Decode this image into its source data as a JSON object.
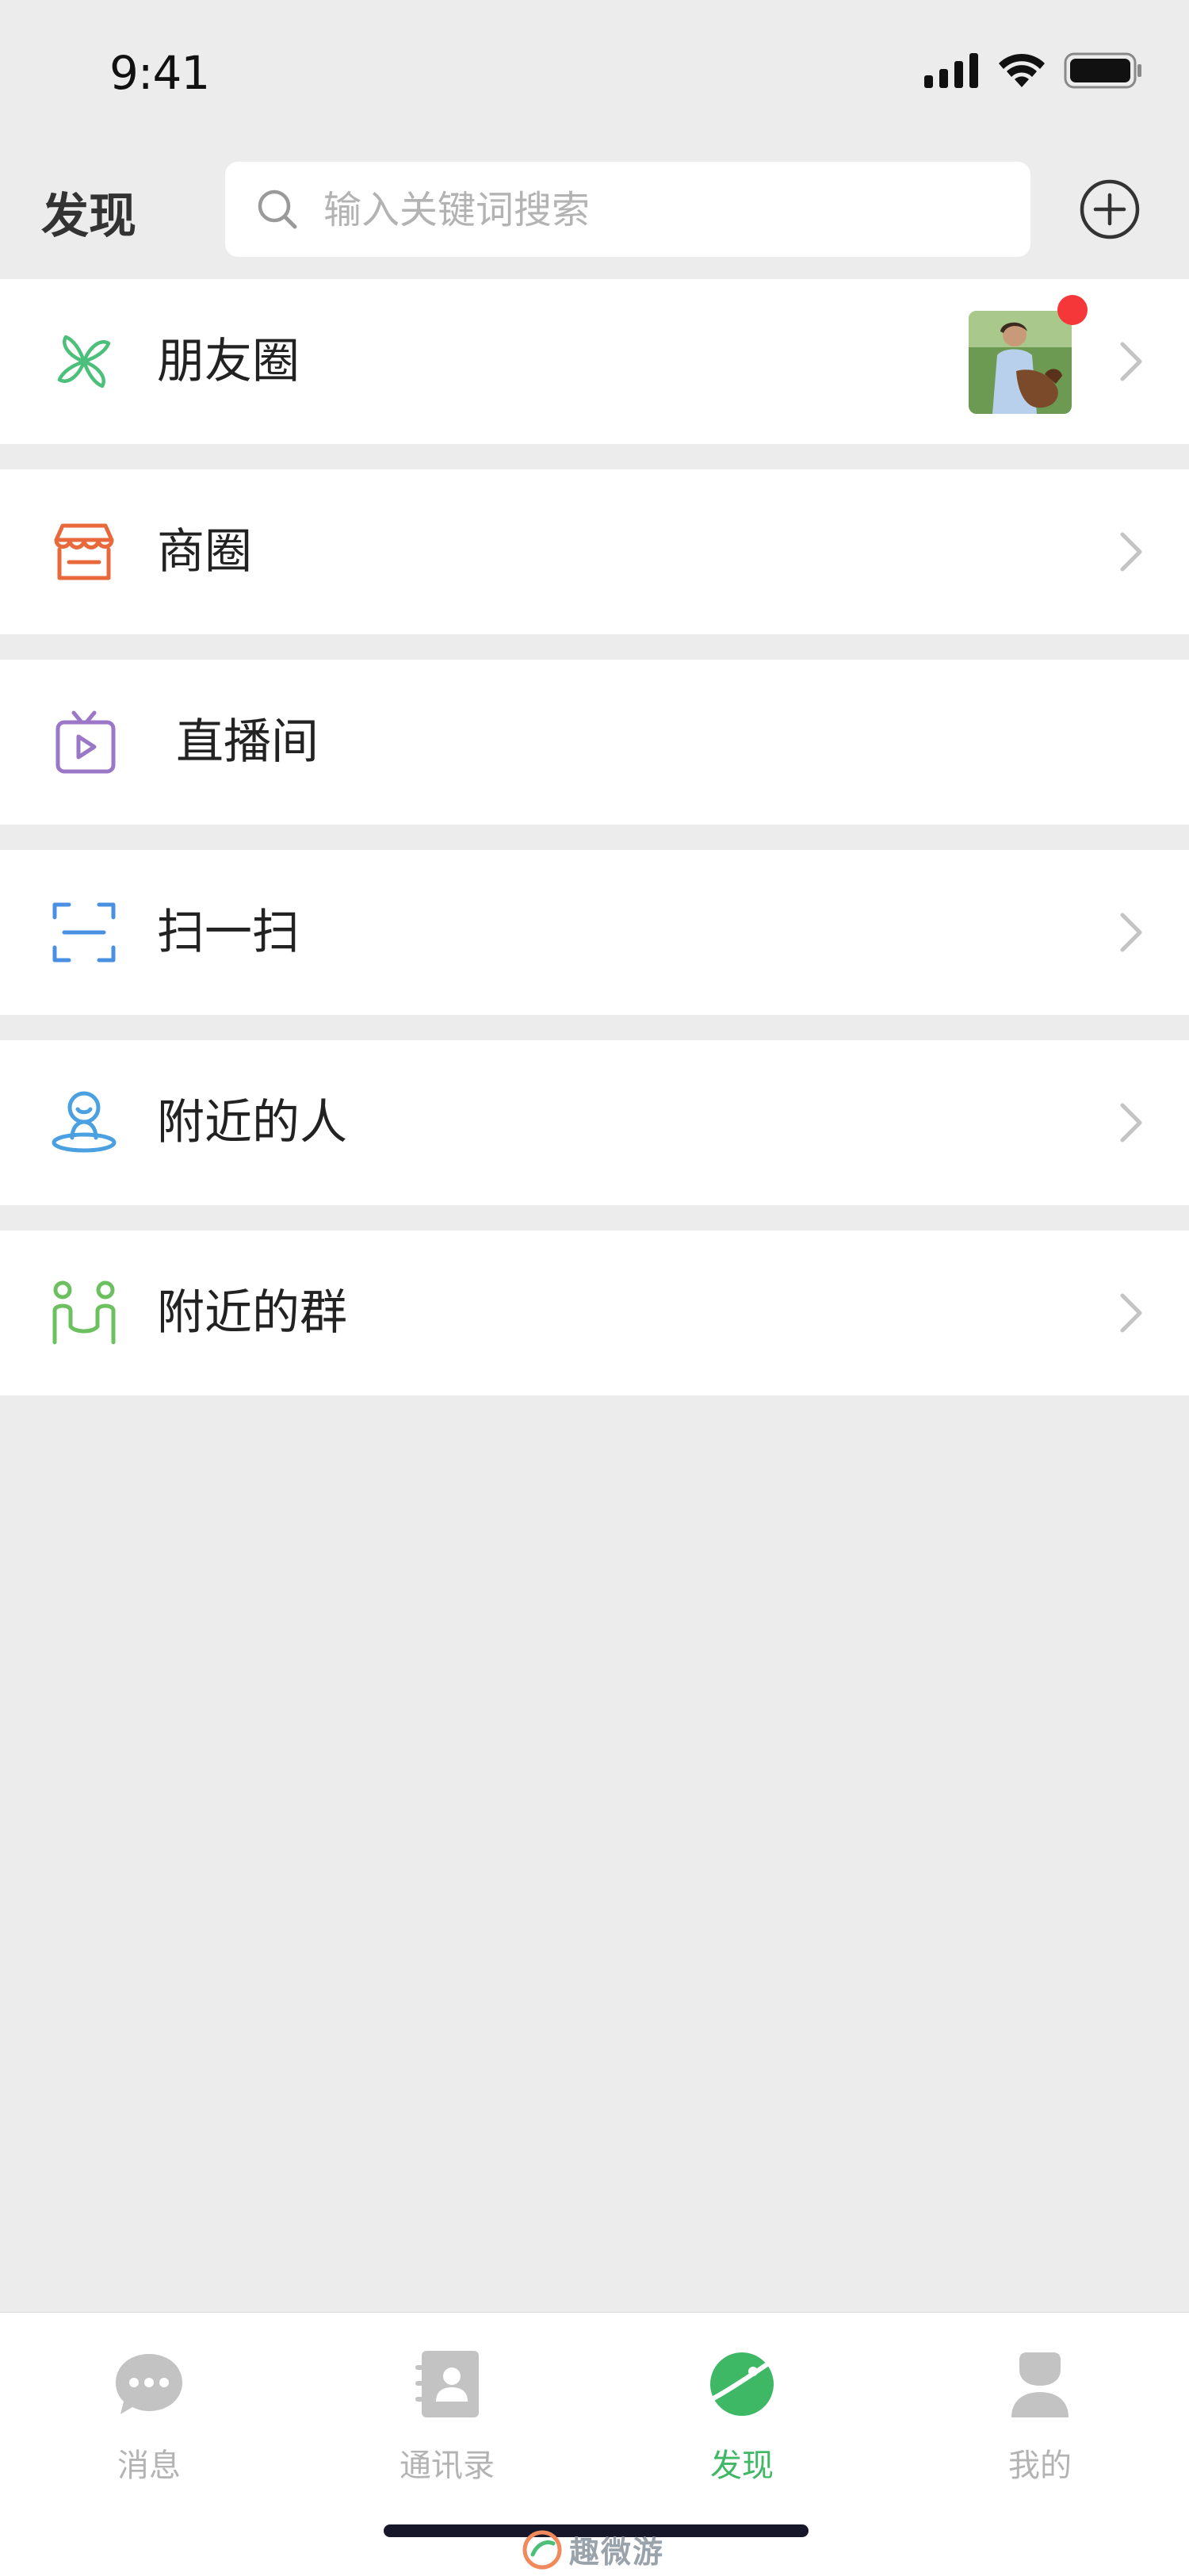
{
  "status": {
    "time": "9:41"
  },
  "header": {
    "title": "发现",
    "search_placeholder": "输入关键词搜索"
  },
  "menu": [
    {
      "label": "朋友圈",
      "icon": "moments-pinwheel-icon",
      "color": "#4cc07a",
      "has_thumbnail": true,
      "has_badge": true
    },
    {
      "label": "商圈",
      "icon": "store-icon",
      "color": "#e86a3c"
    },
    {
      "label": "直播间",
      "icon": "tv-live-icon",
      "color": "#9b77c8"
    },
    {
      "label": "扫一扫",
      "icon": "scan-icon",
      "color": "#4a90e2"
    },
    {
      "label": "附近的人",
      "icon": "nearby-person-icon",
      "color": "#4aa0e0"
    },
    {
      "label": "附近的群",
      "icon": "nearby-group-icon",
      "color": "#6cc060"
    }
  ],
  "tabs": [
    {
      "label": "消息",
      "icon": "chat-bubble-icon",
      "active": false
    },
    {
      "label": "通讯录",
      "icon": "contacts-book-icon",
      "active": false
    },
    {
      "label": "发现",
      "icon": "planet-icon",
      "active": true
    },
    {
      "label": "我的",
      "icon": "person-icon",
      "active": false
    }
  ],
  "colors": {
    "accent": "#3fb865",
    "badge": "#f5373a",
    "inactive": "#b3b3b3",
    "page_bg": "#ececec"
  },
  "watermark": {
    "text": "趣微游"
  }
}
